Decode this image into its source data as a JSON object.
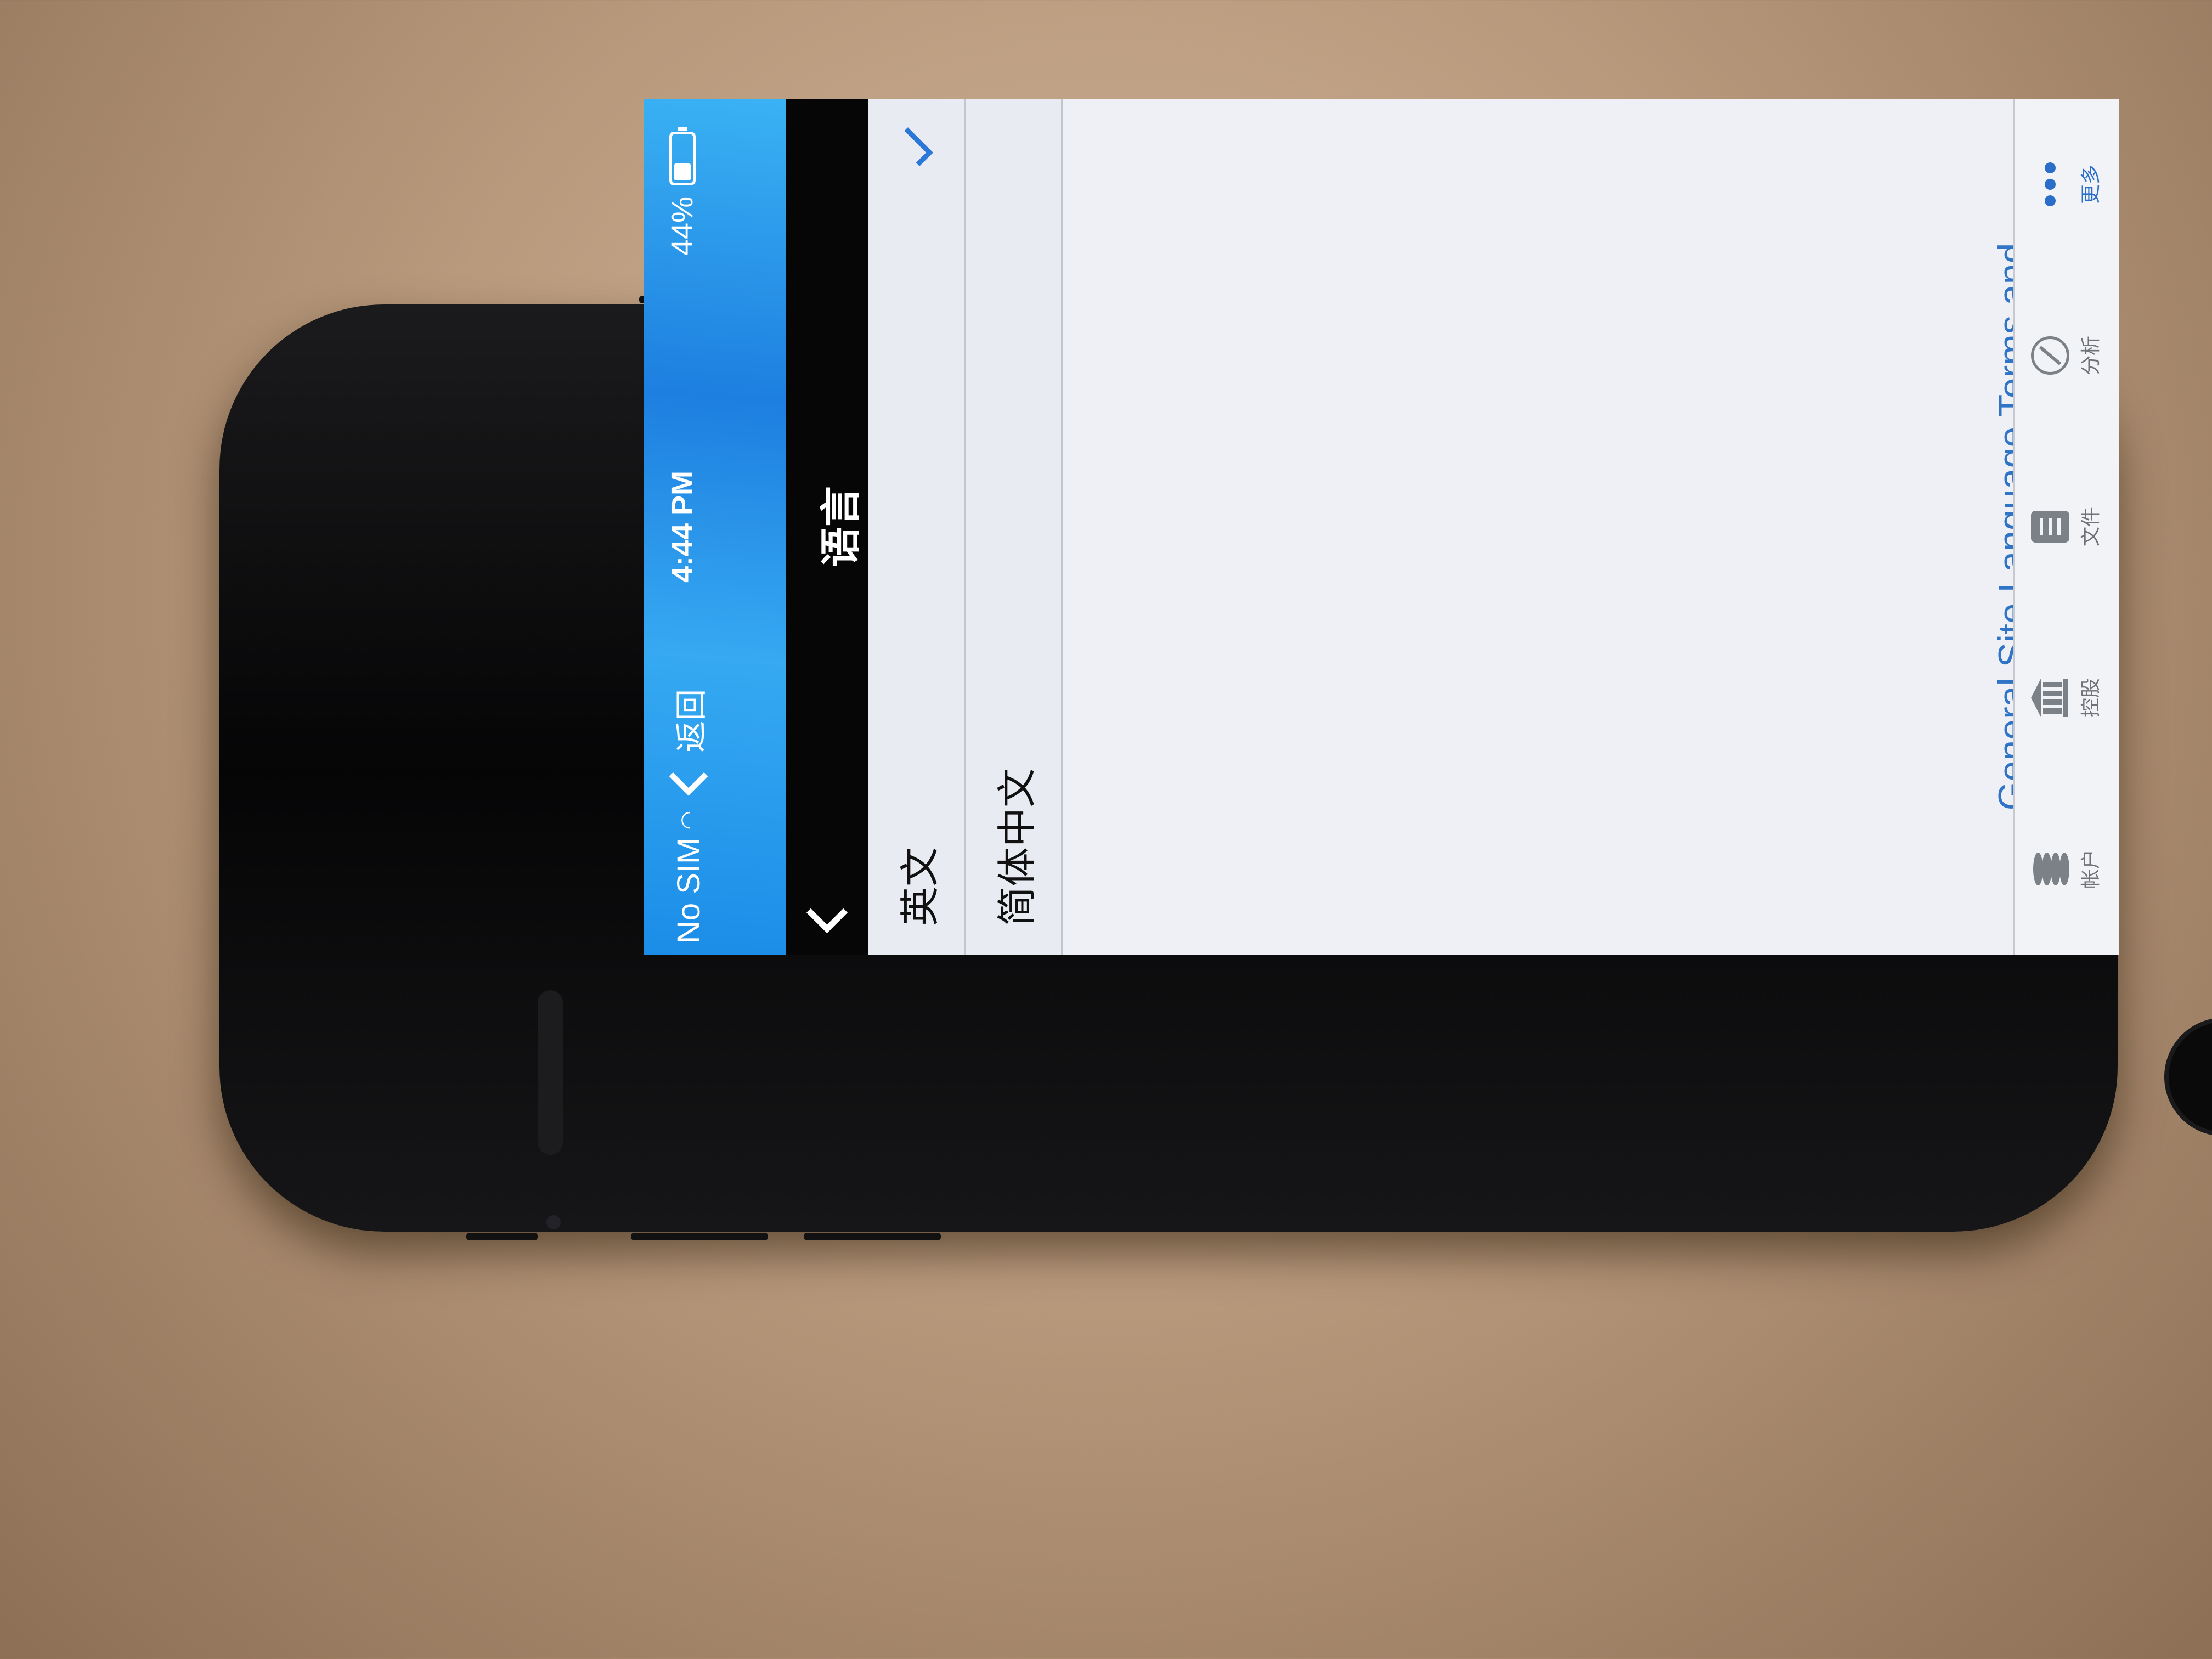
{
  "status_bar": {
    "carrier": "No SIM",
    "back_label": "返回",
    "time": "4:44 PM",
    "battery_percent": "44%",
    "battery_level": 0.44
  },
  "nav": {
    "title": "语言"
  },
  "languages": [
    {
      "label": "英文",
      "selected": true
    },
    {
      "label": "简体中文",
      "selected": false
    }
  ],
  "terms_link": "General Site Language Terms and Conditions",
  "tab_bar": {
    "items": [
      {
        "label": "帐户",
        "icon": "coins-icon",
        "active": false
      },
      {
        "label": "控股",
        "icon": "bank-icon",
        "active": false
      },
      {
        "label": "文件",
        "icon": "document-icon",
        "active": false
      },
      {
        "label": "分析",
        "icon": "compass-icon",
        "active": false
      },
      {
        "label": "更多",
        "icon": "more-icon",
        "active": true
      }
    ]
  },
  "colors": {
    "accent": "#2b6ec9",
    "status_bar": "#1b8de8",
    "nav_bar": "#060607"
  }
}
